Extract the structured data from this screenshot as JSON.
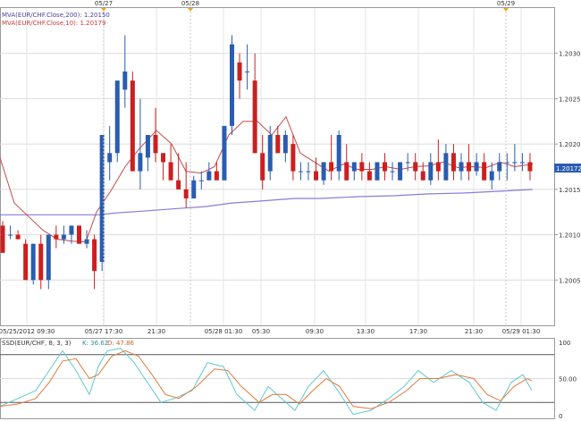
{
  "chart_data": [
    {
      "type": "candlestick",
      "x_tick_labels": [
        "05/25/2012 09:30",
        "05/27 17:30",
        "21:30",
        "05/28 01:30",
        "05:30",
        "09:30",
        "13:30",
        "17:30",
        "21:30",
        "05/29 01:30"
      ],
      "top_date_markers": [
        "05/27",
        "05/28",
        "05/29"
      ],
      "y_ticks": [
        "1.2005",
        "1.2010",
        "1.2015",
        "1.2020",
        "1.2025",
        "1.2030"
      ],
      "ylim": [
        1.2,
        1.2035
      ],
      "last_price_label": "1.20172",
      "legend": [
        {
          "text": "MVA(EUR/CHF.Close,200): 1.20150",
          "color": "#4b3f9c"
        },
        {
          "text": "MVA(EUR/CHF.Close,10): 1.20179",
          "color": "#c83c3c"
        }
      ],
      "colors": {
        "up": "#2a5db0",
        "down": "#cc1f1f",
        "ma200": "#8a7ad6",
        "ma10": "#c84a4a"
      },
      "candles": [
        [
          1.2011,
          1.20115,
          1.2008,
          1.2008
        ],
        [
          1.201,
          1.2011,
          1.20095,
          1.201
        ],
        [
          1.201,
          1.20105,
          1.20095,
          1.20095
        ],
        [
          1.2009,
          1.20095,
          1.2005,
          1.2005
        ],
        [
          1.2005,
          1.2009,
          1.20045,
          1.2009
        ],
        [
          1.2009,
          1.201,
          1.2004,
          1.2005
        ],
        [
          1.2005,
          1.201,
          1.2004,
          1.201
        ],
        [
          1.201,
          1.2011,
          1.20085,
          1.20095
        ],
        [
          1.20095,
          1.2011,
          1.2009,
          1.201
        ],
        [
          1.201,
          1.2011,
          1.2009,
          1.2011
        ],
        [
          1.2011,
          1.2011,
          1.2009,
          1.2009
        ],
        [
          1.2009,
          1.20105,
          1.20085,
          1.20095
        ],
        [
          1.20095,
          1.201,
          1.2004,
          1.2006
        ],
        [
          1.2007,
          1.2021,
          1.2006,
          1.2021
        ],
        [
          1.2018,
          1.2022,
          1.2016,
          1.2019
        ],
        [
          1.2019,
          1.2027,
          1.2018,
          1.2027
        ],
        [
          1.2026,
          1.2032,
          1.2024,
          1.2028
        ],
        [
          1.2027,
          1.2028,
          1.2017,
          1.2017
        ],
        [
          1.2017,
          1.2025,
          1.2015,
          1.2019
        ],
        [
          1.20185,
          1.2021,
          1.2017,
          1.2021
        ],
        [
          1.2021,
          1.2024,
          1.2018,
          1.2019
        ],
        [
          1.2019,
          1.2019,
          1.2016,
          1.2018
        ],
        [
          1.2018,
          1.202,
          1.2017,
          1.2016
        ],
        [
          1.2016,
          1.2019,
          1.2015,
          1.2015
        ],
        [
          1.2015,
          1.2018,
          1.2013,
          1.2014
        ],
        [
          1.2014,
          1.20165,
          1.2014,
          1.2016
        ],
        [
          1.2016,
          1.2017,
          1.2015,
          1.2016
        ],
        [
          1.2016,
          1.2018,
          1.2016,
          1.2017
        ],
        [
          1.2017,
          1.2018,
          1.20165,
          1.2016
        ],
        [
          1.2016,
          1.2022,
          1.2016,
          1.2022
        ],
        [
          1.2022,
          1.2032,
          1.2021,
          1.2031
        ],
        [
          1.2029,
          1.203,
          1.2025,
          1.2027
        ],
        [
          1.2028,
          1.2031,
          1.2026,
          1.2028
        ],
        [
          1.2027,
          1.203,
          1.2019,
          1.2019
        ],
        [
          1.2019,
          1.2021,
          1.2015,
          1.2016
        ],
        [
          1.2017,
          1.2022,
          1.2016,
          1.2021
        ],
        [
          1.2021,
          1.2022,
          1.2019,
          1.2019
        ],
        [
          1.2019,
          1.20215,
          1.2018,
          1.2021
        ],
        [
          1.202,
          1.2021,
          1.2016,
          1.2017
        ],
        [
          1.2017,
          1.2018,
          1.2016,
          1.2017
        ],
        [
          1.2017,
          1.2018,
          1.2016,
          1.2017
        ],
        [
          1.2017,
          1.20185,
          1.2016,
          1.2016
        ],
        [
          1.2016,
          1.2018,
          1.20155,
          1.2018
        ],
        [
          1.2018,
          1.2021,
          1.2016,
          1.2017
        ],
        [
          1.2017,
          1.20215,
          1.2016,
          1.2021
        ],
        [
          1.2018,
          1.202,
          1.2016,
          1.2016
        ],
        [
          1.2017,
          1.2018,
          1.2016,
          1.2018
        ],
        [
          1.2018,
          1.2019,
          1.2016,
          1.2017
        ],
        [
          1.2017,
          1.2018,
          1.2016,
          1.2016
        ],
        [
          1.2016,
          1.2018,
          1.2016,
          1.2018
        ],
        [
          1.2018,
          1.2019,
          1.2016,
          1.2017
        ],
        [
          1.2017,
          1.2018,
          1.2016,
          1.2017
        ],
        [
          1.2016,
          1.2018,
          1.2016,
          1.2018
        ],
        [
          1.2018,
          1.2019,
          1.2017,
          1.2018
        ],
        [
          1.2018,
          1.2019,
          1.2016,
          1.2017
        ],
        [
          1.2017,
          1.2018,
          1.2016,
          1.2016
        ],
        [
          1.2016,
          1.2019,
          1.20155,
          1.2018
        ],
        [
          1.2018,
          1.20205,
          1.2016,
          1.2017
        ],
        [
          1.2016,
          1.202,
          1.2016,
          1.2019
        ],
        [
          1.2019,
          1.202,
          1.2016,
          1.2017
        ],
        [
          1.2017,
          1.2019,
          1.2016,
          1.2018
        ],
        [
          1.2018,
          1.202,
          1.2016,
          1.2017
        ],
        [
          1.2017,
          1.2019,
          1.20165,
          1.2018
        ],
        [
          1.2018,
          1.2019,
          1.2016,
          1.2016
        ],
        [
          1.2016,
          1.2018,
          1.2015,
          1.2017
        ],
        [
          1.2017,
          1.2019,
          1.2016,
          1.2018
        ],
        [
          1.2018,
          1.2019,
          1.2016,
          1.2018
        ],
        [
          1.2018,
          1.202,
          1.2017,
          1.2018
        ],
        [
          1.2018,
          1.2019,
          1.2017,
          1.2018
        ],
        [
          1.2018,
          1.2019,
          1.2016,
          1.2017
        ]
      ],
      "ma10": [
        [
          0,
          1.20185
        ],
        [
          16,
          1.20135
        ],
        [
          32,
          1.2012
        ],
        [
          48,
          1.20105
        ],
        [
          64,
          1.20095
        ],
        [
          80,
          1.20093
        ],
        [
          96,
          1.20092
        ],
        [
          108,
          1.20125
        ],
        [
          125,
          1.2015
        ],
        [
          140,
          1.20175
        ],
        [
          156,
          1.20195
        ],
        [
          175,
          1.20215
        ],
        [
          192,
          1.202
        ],
        [
          208,
          1.2017
        ],
        [
          225,
          1.20168
        ],
        [
          240,
          1.20175
        ],
        [
          256,
          1.2021
        ],
        [
          272,
          1.20225
        ],
        [
          288,
          1.20225
        ],
        [
          304,
          1.2021
        ],
        [
          320,
          1.2023
        ],
        [
          336,
          1.2019
        ],
        [
          352,
          1.2018
        ],
        [
          368,
          1.2017
        ],
        [
          384,
          1.20178
        ],
        [
          400,
          1.20172
        ],
        [
          416,
          1.20172
        ],
        [
          432,
          1.20175
        ],
        [
          448,
          1.20172
        ],
        [
          464,
          1.20175
        ],
        [
          480,
          1.20176
        ],
        [
          496,
          1.2018
        ],
        [
          512,
          1.20174
        ],
        [
          528,
          1.20175
        ],
        [
          544,
          1.20174
        ],
        [
          560,
          1.2018
        ],
        [
          576,
          1.20175
        ],
        [
          596,
          1.20178
        ]
      ],
      "ma200": [
        [
          0,
          1.20122
        ],
        [
          40,
          1.20122
        ],
        [
          80,
          1.20122
        ],
        [
          110,
          1.20122
        ],
        [
          130,
          1.20124
        ],
        [
          160,
          1.20126
        ],
        [
          200,
          1.20129
        ],
        [
          230,
          1.20131
        ],
        [
          260,
          1.20135
        ],
        [
          290,
          1.20137
        ],
        [
          330,
          1.2014
        ],
        [
          360,
          1.2014
        ],
        [
          400,
          1.20142
        ],
        [
          440,
          1.20143
        ],
        [
          480,
          1.20145
        ],
        [
          520,
          1.20146
        ],
        [
          560,
          1.20148
        ],
        [
          596,
          1.2015
        ]
      ]
    },
    {
      "type": "line",
      "legend": {
        "title": "SSD(EUR/CHF, 8, 3, 3)",
        "k": "K: 36.62",
        "d": "D: 47.86"
      },
      "y_ticks": [
        "0",
        "50.00",
        "100"
      ],
      "ylim": [
        0,
        100
      ],
      "levels": [
        20,
        80
      ],
      "series": [
        {
          "color": "#5ec8cf",
          "values": [
            [
              0,
              15
            ],
            [
              20,
              25
            ],
            [
              40,
              35
            ],
            [
              55,
              60
            ],
            [
              70,
              85
            ],
            [
              85,
              60
            ],
            [
              100,
              30
            ],
            [
              110,
              65
            ],
            [
              120,
              85
            ],
            [
              135,
              88
            ],
            [
              150,
              70
            ],
            [
              165,
              45
            ],
            [
              180,
              20
            ],
            [
              195,
              25
            ],
            [
              215,
              35
            ],
            [
              232,
              70
            ],
            [
              250,
              65
            ],
            [
              265,
              30
            ],
            [
              285,
              10
            ],
            [
              300,
              40
            ],
            [
              315,
              25
            ],
            [
              330,
              10
            ],
            [
              345,
              40
            ],
            [
              362,
              60
            ],
            [
              378,
              35
            ],
            [
              395,
              5
            ],
            [
              415,
              10
            ],
            [
              435,
              25
            ],
            [
              452,
              40
            ],
            [
              468,
              60
            ],
            [
              485,
              45
            ],
            [
              505,
              60
            ],
            [
              525,
              45
            ],
            [
              540,
              20
            ],
            [
              555,
              10
            ],
            [
              572,
              45
            ],
            [
              585,
              55
            ],
            [
              595,
              35
            ]
          ]
        },
        {
          "color": "#e07b3c",
          "values": [
            [
              0,
              15
            ],
            [
              20,
              18
            ],
            [
              40,
              25
            ],
            [
              55,
              45
            ],
            [
              70,
              72
            ],
            [
              85,
              75
            ],
            [
              100,
              50
            ],
            [
              110,
              55
            ],
            [
              125,
              78
            ],
            [
              140,
              85
            ],
            [
              155,
              78
            ],
            [
              170,
              55
            ],
            [
              185,
              30
            ],
            [
              200,
              25
            ],
            [
              220,
              40
            ],
            [
              240,
              62
            ],
            [
              255,
              60
            ],
            [
              270,
              40
            ],
            [
              290,
              20
            ],
            [
              305,
              30
            ],
            [
              320,
              30
            ],
            [
              335,
              18
            ],
            [
              350,
              35
            ],
            [
              365,
              50
            ],
            [
              380,
              40
            ],
            [
              395,
              15
            ],
            [
              415,
              12
            ],
            [
              435,
              20
            ],
            [
              455,
              35
            ],
            [
              470,
              50
            ],
            [
              490,
              50
            ],
            [
              510,
              55
            ],
            [
              530,
              50
            ],
            [
              545,
              30
            ],
            [
              560,
              22
            ],
            [
              575,
              40
            ],
            [
              590,
              50
            ],
            [
              595,
              47
            ]
          ]
        }
      ]
    }
  ]
}
